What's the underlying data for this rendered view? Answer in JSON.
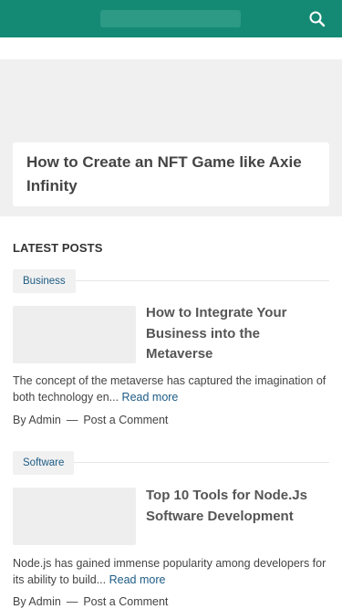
{
  "header": {
    "search_icon": "search-icon"
  },
  "featured": {
    "title": "How to Create an NFT Game like Axie Infinity"
  },
  "latest_posts": {
    "heading": "LATEST POSTS",
    "posts": [
      {
        "category": "Business",
        "title": "How to Integrate Your Business into the Metaverse",
        "excerpt": "The concept of the metaverse has captured the imagination of both technology en...",
        "read_more": "Read more",
        "author": "By Admin",
        "separator": "—",
        "comment": "Post a Comment"
      },
      {
        "category": "Software",
        "title": "Top 10 Tools for Node.Js Software Development",
        "excerpt": "Node.js has gained immense popularity among developers for its ability to build...",
        "read_more": "Read more",
        "author": "By Admin",
        "separator": "—",
        "comment": "Post a Comment"
      }
    ]
  }
}
